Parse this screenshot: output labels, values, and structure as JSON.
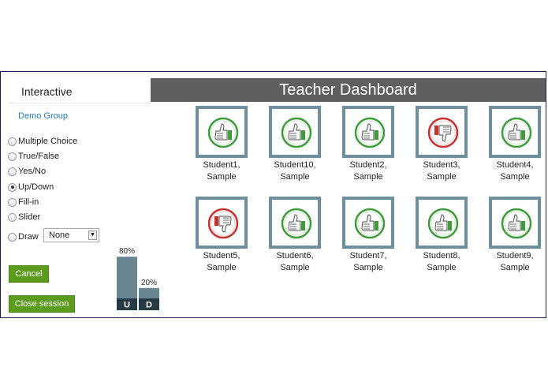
{
  "sidebar": {
    "title": "Interactive",
    "group_link": "Demo Group",
    "question_types": [
      {
        "label": "Multiple Choice",
        "checked": false
      },
      {
        "label": "True/False",
        "checked": false
      },
      {
        "label": "Yes/No",
        "checked": false
      },
      {
        "label": "Up/Down",
        "checked": true
      },
      {
        "label": "Fill-in",
        "checked": false
      },
      {
        "label": "Slider",
        "checked": false
      },
      {
        "label": "Draw",
        "checked": false
      }
    ],
    "draw_select": {
      "value": "None"
    },
    "cancel_label": "Cancel",
    "close_label": "Close session"
  },
  "chart_data": {
    "type": "bar",
    "categories": [
      "U",
      "D"
    ],
    "values": [
      80,
      20
    ],
    "value_labels": [
      "80%",
      "20%"
    ],
    "ylim": [
      0,
      100
    ]
  },
  "header": {
    "title": "Teacher Dashboard"
  },
  "students": [
    {
      "line1": "Student1,",
      "line2": "Sample",
      "vote": "up"
    },
    {
      "line1": "Student10,",
      "line2": "Sample",
      "vote": "up"
    },
    {
      "line1": "Student2,",
      "line2": "Sample",
      "vote": "up"
    },
    {
      "line1": "Student3,",
      "line2": "Sample",
      "vote": "down"
    },
    {
      "line1": "Student4,",
      "line2": "Sample",
      "vote": "up"
    },
    {
      "line1": "Student5,",
      "line2": "Sample",
      "vote": "down"
    },
    {
      "line1": "Student6,",
      "line2": "Sample",
      "vote": "up"
    },
    {
      "line1": "Student7,",
      "line2": "Sample",
      "vote": "up"
    },
    {
      "line1": "Student8,",
      "line2": "Sample",
      "vote": "up"
    },
    {
      "line1": "Student9,",
      "line2": "Sample",
      "vote": "up"
    }
  ],
  "colors": {
    "up": "#3f9b3a",
    "down": "#c8302e",
    "tile_border": "#6f8f9c",
    "bar": "#6a8592",
    "bar_label_bg": "#263a45",
    "button": "#5c9b1d",
    "header_bg": "#5f5f5f"
  },
  "icons": {
    "up": "thumbs-up-icon",
    "down": "thumbs-down-icon"
  }
}
